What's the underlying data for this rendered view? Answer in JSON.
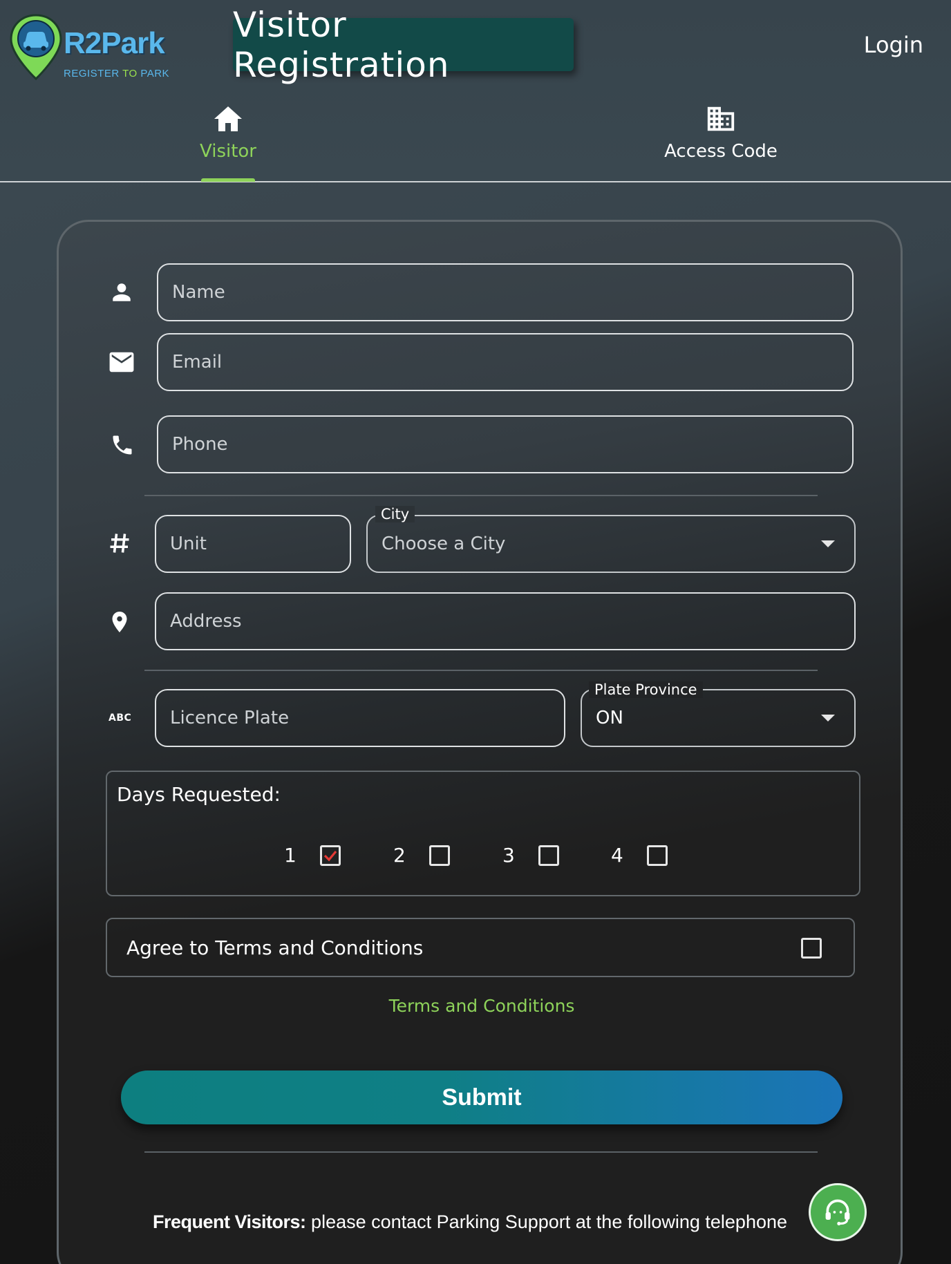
{
  "app": {
    "logo_title": "R2Park",
    "logo_sub_a": "REGISTER",
    "logo_sub_b": "TO",
    "logo_sub_c": "PARK",
    "page_title": "Visitor Registration",
    "login_label": "Login"
  },
  "tabs": [
    {
      "label": "Visitor",
      "icon": "home-icon",
      "active": true
    },
    {
      "label": "Access Code",
      "icon": "building-icon",
      "active": false
    }
  ],
  "form": {
    "name_placeholder": "Name",
    "email_placeholder": "Email",
    "phone_placeholder": "Phone",
    "unit_placeholder": "Unit",
    "city_label": "City",
    "city_value": "Choose a City",
    "address_placeholder": "Address",
    "plate_placeholder": "Licence Plate",
    "plate_icon_text": "ABC",
    "province_label": "Plate Province",
    "province_value": "ON",
    "days_title": "Days Requested:",
    "days": [
      {
        "label": "1",
        "checked": true
      },
      {
        "label": "2",
        "checked": false
      },
      {
        "label": "3",
        "checked": false
      },
      {
        "label": "4",
        "checked": false
      }
    ],
    "terms_agree_label": "Agree to Terms and Conditions",
    "terms_agree_checked": false,
    "terms_link": "Terms and Conditions",
    "submit_label": "Submit"
  },
  "footer": {
    "bold": "Frequent Visitors:",
    "text": " please contact Parking Support at the following telephone"
  },
  "colors": {
    "accent_green": "#8ed35a",
    "title_bg": "#124a48",
    "check_red": "#e53935",
    "support_green": "#4caf50"
  }
}
